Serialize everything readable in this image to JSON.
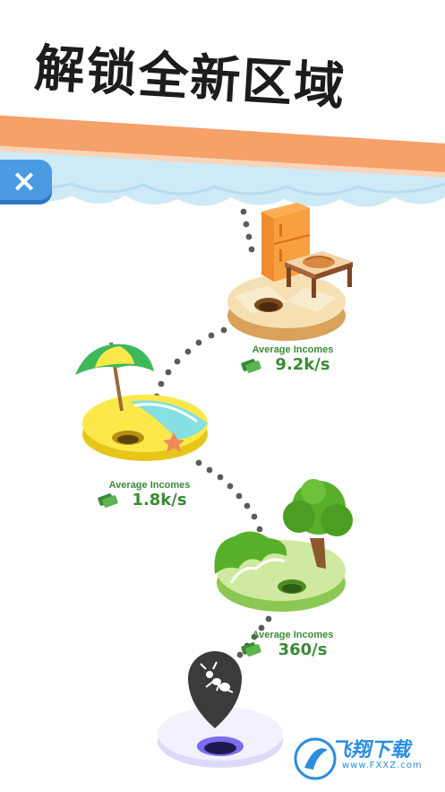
{
  "banner": {
    "title": "解锁全新区域"
  },
  "close_button": {
    "icon": "close-icon",
    "label": "×"
  },
  "islands": [
    {
      "name": "kitchen",
      "income_label": "Average Incomes",
      "income_value": "9.2k/s"
    },
    {
      "name": "beach",
      "income_label": "Average Incomes",
      "income_value": "1.8k/s"
    },
    {
      "name": "forest",
      "income_label": "Average Incomes",
      "income_value": "360/s"
    },
    {
      "name": "anthill",
      "marker_icon": "ant-pin-icon"
    }
  ],
  "watermark": {
    "text": "飞翔下载",
    "url": "www.FXXZ.com"
  },
  "colors": {
    "sky": "#cfeaf7",
    "banner_stripe": "#f6a06a",
    "close_button": "#4b9be3",
    "income_text": "#3a8a36"
  }
}
